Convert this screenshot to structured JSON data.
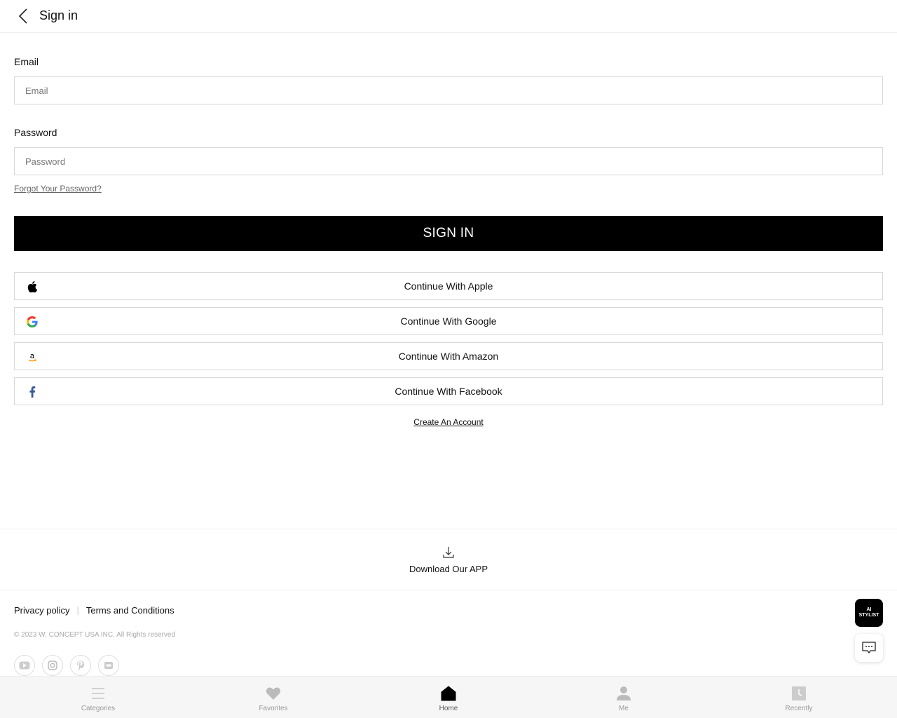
{
  "header": {
    "title": "Sign in"
  },
  "form": {
    "email_label": "Email",
    "email_placeholder": "Email",
    "email_value": "",
    "password_label": "Password",
    "password_placeholder": "Password",
    "password_value": "",
    "forgot_label": "Forgot Your Password?",
    "signin_label": "SIGN IN"
  },
  "social": [
    {
      "label": "Continue With Apple",
      "icon": "apple-icon"
    },
    {
      "label": "Continue With Google",
      "icon": "google-icon"
    },
    {
      "label": "Continue With Amazon",
      "icon": "amazon-icon"
    },
    {
      "label": "Continue With Facebook",
      "icon": "facebook-icon"
    }
  ],
  "create_account_label": "Create An Account",
  "download": {
    "label": "Download Our APP",
    "icon": "download-icon"
  },
  "footer": {
    "privacy_label": "Privacy policy",
    "separator": "|",
    "terms_label": "Terms and Conditions",
    "copyright": "© 2023 W. CONCEPT USA INC. All Rights reserved",
    "social_icons": [
      "youtube-icon",
      "instagram-icon",
      "pinterest-icon",
      "app-icon"
    ]
  },
  "ai_stylist": {
    "line1": "AI",
    "line2": "STYLIST"
  },
  "bottom_nav": {
    "items": [
      {
        "label": "Categories",
        "icon": "menu-icon",
        "active": false
      },
      {
        "label": "Favorites",
        "icon": "heart-icon",
        "active": false
      },
      {
        "label": "Home",
        "icon": "home-icon",
        "active": true
      },
      {
        "label": "Me",
        "icon": "person-icon",
        "active": false
      },
      {
        "label": "Recently",
        "icon": "clock-icon",
        "active": false
      }
    ]
  },
  "colors": {
    "primary": "#000000",
    "border": "#d8d8d8",
    "muted": "#999999"
  }
}
